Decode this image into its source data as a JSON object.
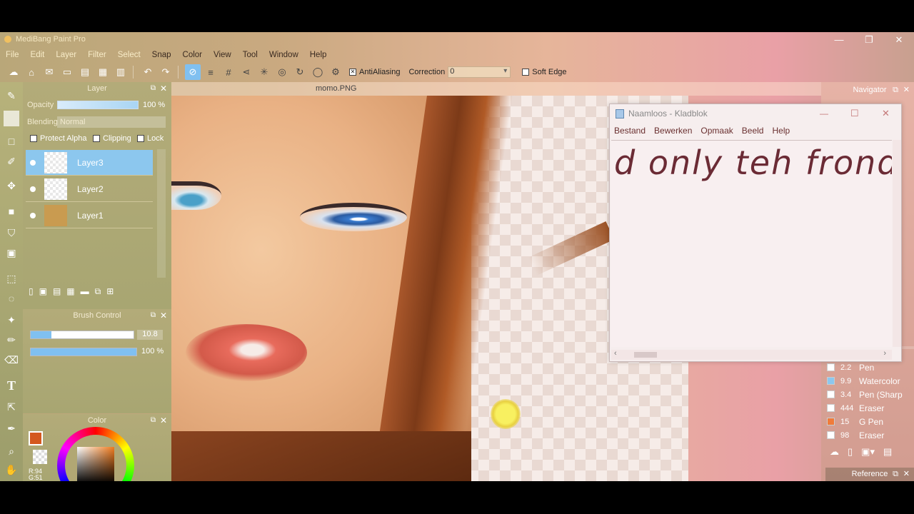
{
  "app": {
    "title": "MediBang Paint Pro",
    "window_buttons": [
      "—",
      "❐",
      "✕"
    ]
  },
  "menu": [
    "File",
    "Edit",
    "Layer",
    "Filter",
    "Select",
    "Snap",
    "Color",
    "View",
    "Tool",
    "Window",
    "Help"
  ],
  "toolbar": {
    "antialiasing_label": "AntiAliasing",
    "antialiasing_checked": true,
    "correction_label": "Correction",
    "correction_value": "0",
    "softedge_label": "Soft Edge",
    "softedge_checked": false
  },
  "layer_panel": {
    "title": "Layer",
    "opacity_label": "Opacity",
    "opacity_value": "100 %",
    "opacity_fraction": 1.0,
    "blending_label": "Blending",
    "blending_value": "Normal",
    "protect_alpha": "Protect Alpha",
    "clipping": "Clipping",
    "lock": "Lock",
    "layers": [
      {
        "name": "Layer3",
        "selected": true
      },
      {
        "name": "Layer2",
        "selected": false
      },
      {
        "name": "Layer1",
        "selected": false
      }
    ]
  },
  "brush_control": {
    "title": "Brush Control",
    "size_value": "10.8",
    "size_fraction": 0.2,
    "opacity_value": "100 %",
    "opacity_fraction": 1.0
  },
  "color_panel": {
    "title": "Color",
    "primary": "#d4581e",
    "readout_r": "R:94",
    "readout_g": "G:51"
  },
  "canvas": {
    "tab": "momo.PNG"
  },
  "notepad": {
    "title": "Naamloos - Kladblok",
    "menu": [
      "Bestand",
      "Bewerken",
      "Opmaak",
      "Beeld",
      "Help"
    ],
    "content": "d only teh frond",
    "buttons": [
      "—",
      "☐",
      "✕"
    ]
  },
  "navigator": {
    "title": "Navigator"
  },
  "brushes": [
    {
      "size": "2.2",
      "name": "Pen",
      "color": "#ffffff"
    },
    {
      "size": "9.9",
      "name": "Watercolor",
      "color": "#8cc7ee"
    },
    {
      "size": "3.4",
      "name": "Pen (Sharp",
      "color": "#ffffff"
    },
    {
      "size": "444",
      "name": "Eraser",
      "color": "#ffffff"
    },
    {
      "size": "15",
      "name": "G Pen",
      "color": "#f07b3a"
    },
    {
      "size": "98",
      "name": "Eraser",
      "color": "#ffffff"
    }
  ],
  "reference": {
    "title": "Reference"
  }
}
